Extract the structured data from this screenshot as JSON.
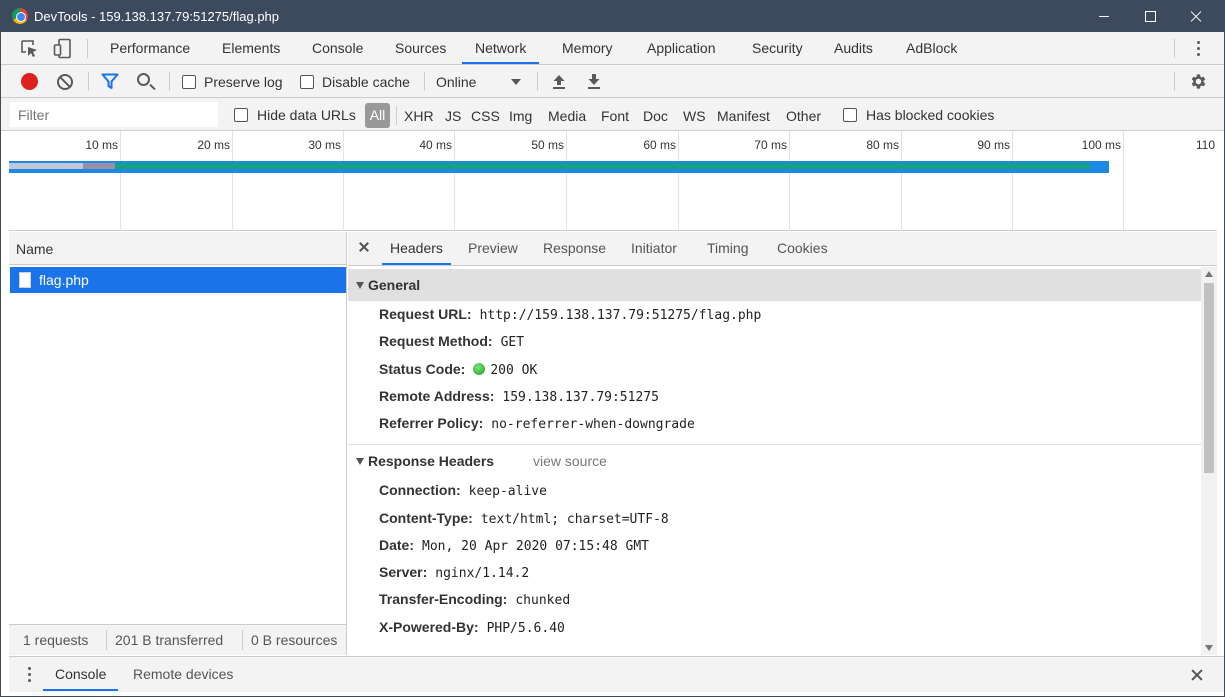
{
  "window": {
    "title": "DevTools - 159.138.137.79:51275/flag.php"
  },
  "tabs": [
    {
      "label": "Performance"
    },
    {
      "label": "Elements"
    },
    {
      "label": "Console"
    },
    {
      "label": "Sources"
    },
    {
      "label": "Network"
    },
    {
      "label": "Memory"
    },
    {
      "label": "Application"
    },
    {
      "label": "Security"
    },
    {
      "label": "Audits"
    },
    {
      "label": "AdBlock"
    }
  ],
  "active_tab": "Network",
  "toolbar": {
    "preserve_log": "Preserve log",
    "disable_cache": "Disable cache",
    "throttling": "Online"
  },
  "filterbar": {
    "placeholder": "Filter",
    "hide_data_urls": "Hide data URLs",
    "types": [
      "All",
      "XHR",
      "JS",
      "CSS",
      "Img",
      "Media",
      "Font",
      "Doc",
      "WS",
      "Manifest",
      "Other"
    ],
    "has_blocked_cookies": "Has blocked cookies"
  },
  "overview": {
    "ticks": [
      "10 ms",
      "20 ms",
      "30 ms",
      "40 ms",
      "50 ms",
      "60 ms",
      "70 ms",
      "80 ms",
      "90 ms",
      "100 ms",
      "110"
    ]
  },
  "request_list": {
    "header": "Name",
    "rows": [
      {
        "name": "flag.php"
      }
    ],
    "status": {
      "requests": "1 requests",
      "transferred": "201 B transferred",
      "resources": "0 B resources"
    }
  },
  "detail_tabs": [
    "Headers",
    "Preview",
    "Response",
    "Initiator",
    "Timing",
    "Cookies"
  ],
  "general": {
    "title": "General",
    "rows": [
      {
        "key": "Request URL:",
        "value": "http://159.138.137.79:51275/flag.php"
      },
      {
        "key": "Request Method:",
        "value": "GET"
      },
      {
        "key": "Status Code:",
        "value": "200 OK"
      },
      {
        "key": "Remote Address:",
        "value": "159.138.137.79:51275"
      },
      {
        "key": "Referrer Policy:",
        "value": "no-referrer-when-downgrade"
      }
    ]
  },
  "response_headers": {
    "title": "Response Headers",
    "view_source": "view source",
    "rows": [
      {
        "key": "Connection:",
        "value": "keep-alive"
      },
      {
        "key": "Content-Type:",
        "value": "text/html; charset=UTF-8"
      },
      {
        "key": "Date:",
        "value": "Mon, 20 Apr 2020 07:15:48 GMT"
      },
      {
        "key": "Server:",
        "value": "nginx/1.14.2"
      },
      {
        "key": "Transfer-Encoding:",
        "value": "chunked"
      },
      {
        "key": "X-Powered-By:",
        "value": "PHP/5.6.40"
      }
    ]
  },
  "drawer": {
    "tabs": [
      "Console",
      "Remote devices"
    ]
  },
  "colors": {
    "accent": "#1a73e8",
    "titlebar": "#3d4a5d",
    "record": "#e0201d",
    "timeline_bar": "#16a085",
    "status_ok": "#1c9e1c"
  }
}
